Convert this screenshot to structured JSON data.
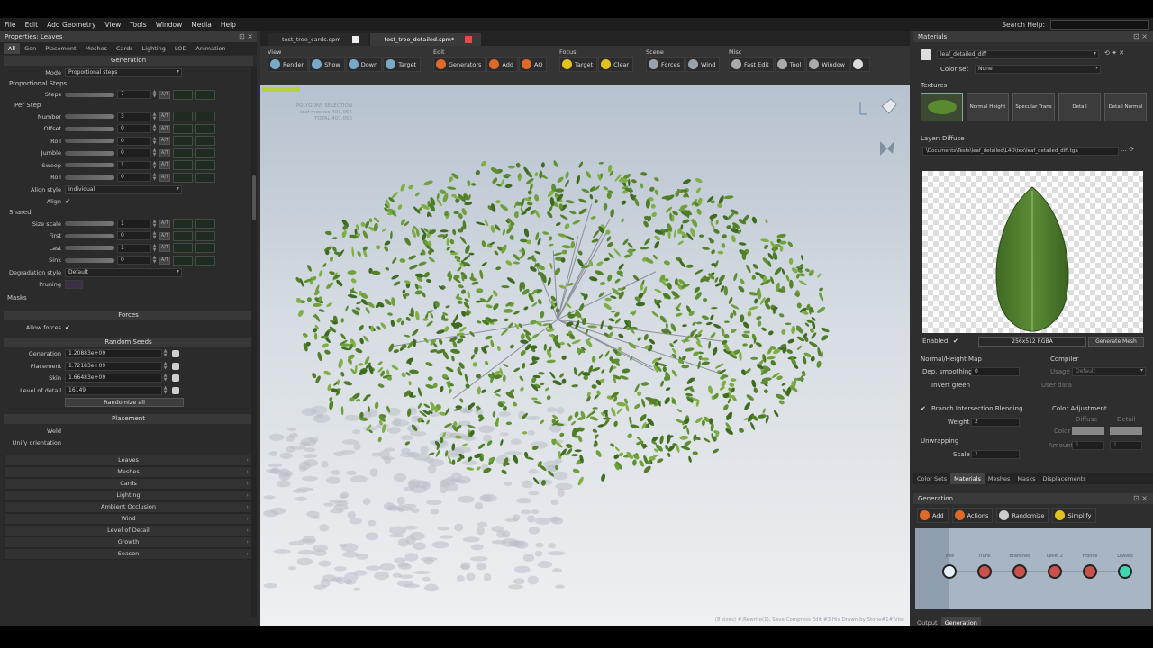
{
  "menu": [
    "File",
    "Edit",
    "Add Geometry",
    "View",
    "Tools",
    "Window",
    "Media",
    "Help"
  ],
  "search_help": "Search Help:",
  "left": {
    "title": "Properties: Leaves",
    "tabs": [
      "All",
      "Gen",
      "Placement",
      "Meshes",
      "Cards",
      "Lighting",
      "LOD",
      "Animation"
    ],
    "generation_header": "Generation",
    "mode_label": "Mode",
    "mode_value": "Proportional steps",
    "proportional_steps": "Proportional Steps",
    "steps_label": "Steps",
    "steps_value": "7",
    "per_step": "Per Step",
    "per_step_rows": [
      {
        "label": "Number",
        "value": "3"
      },
      {
        "label": "Offset",
        "value": "0"
      },
      {
        "label": "Roll",
        "value": "0"
      },
      {
        "label": "Jumble",
        "value": "0"
      },
      {
        "label": "Sweep",
        "value": "1"
      },
      {
        "label": "Roll",
        "value": "0"
      }
    ],
    "align_style_label": "Align style",
    "align_style_value": "Individual",
    "align_label": "Align",
    "shared": "Shared",
    "shared_rows": [
      {
        "label": "Size scale",
        "value": "1"
      },
      {
        "label": "First",
        "value": "0"
      },
      {
        "label": "Last",
        "value": "1"
      },
      {
        "label": "Sink",
        "value": "0"
      }
    ],
    "degradation_label": "Degradation style",
    "degradation_value": "Default",
    "pruning_label": "Pruning",
    "masks": "Masks",
    "forces_header": "Forces",
    "allow_forces": "Allow forces",
    "random_header": "Random Seeds",
    "seeds": [
      {
        "label": "Generation",
        "value": "1.20883e+09"
      },
      {
        "label": "Placement",
        "value": "1.72183e+09"
      },
      {
        "label": "Skin",
        "value": "1.66483e+09"
      },
      {
        "label": "Level of detail",
        "value": "16149"
      }
    ],
    "randomize_all": "Randomize all",
    "placement_header": "Placement",
    "weld_label": "Weld",
    "unify_label": "Unify orientation",
    "collapsed": [
      "Leaves",
      "Meshes",
      "Cards",
      "Lighting",
      "Ambient Occlusion",
      "Wind",
      "Level of Detail",
      "Growth",
      "Season"
    ]
  },
  "center": {
    "tabs": [
      {
        "label": "test_tree_cards.spm",
        "active": false
      },
      {
        "label": "test_tree_detailed.spm*",
        "active": true
      }
    ],
    "groups": [
      {
        "title": "View",
        "buttons": [
          {
            "label": "Render",
            "color": "#79a9c9"
          },
          {
            "label": "Show",
            "color": "#79a9c9"
          },
          {
            "label": "Down",
            "color": "#79a9c9"
          },
          {
            "label": "Target",
            "color": "#79a9c9"
          }
        ]
      },
      {
        "title": "Edit",
        "buttons": [
          {
            "label": "Generators",
            "color": "#e0692a"
          },
          {
            "label": "Add",
            "color": "#e0692a"
          },
          {
            "label": "AO",
            "color": "#e0692a"
          }
        ]
      },
      {
        "title": "Focus",
        "buttons": [
          {
            "label": "Target",
            "color": "#e2c21f"
          },
          {
            "label": "Clear",
            "color": "#e2c21f"
          }
        ]
      },
      {
        "title": "Scene",
        "buttons": [
          {
            "label": "Forces",
            "color": "#9aa3ad"
          },
          {
            "label": "Wind",
            "color": "#9aa3ad"
          }
        ]
      },
      {
        "title": "Misc",
        "buttons": [
          {
            "label": "Fast Edit",
            "color": "#aaaaaa"
          },
          {
            "label": "Tool",
            "color": "#aaaaaa"
          },
          {
            "label": "Window",
            "color": "#aaaaaa"
          },
          {
            "label": "",
            "color": "#dddddd"
          }
        ]
      }
    ],
    "viewport": {
      "info_lines": [
        "POLYGONS   SELECTION",
        "leaf meshes  401,056",
        "TOTAL  401,056"
      ],
      "status": "(8 sizes) #:Rewrite(1), Save Compress Edit #3  Hix Drawn by Stone#1#  Visc"
    }
  },
  "right": {
    "title": "Materials",
    "material_name": "leaf_detailed_diff",
    "color_set_label": "Color set",
    "color_set_value": "None",
    "textures_label": "Textures",
    "tex_slots": [
      "Normal Height",
      "Specular Trans",
      "Detail",
      "Detail Normal"
    ],
    "layer_label": "Layer: Diffuse",
    "path": "\\Documents\\Tests\\leaf_detailed\\L4O\\tex\\leaf_detailed_diff.tga",
    "enabled_label": "Enabled",
    "image_info": "256x512 RGBA",
    "generate_mesh": "Generate Mesh",
    "normal_height": "Normal/Height Map",
    "dep_smoothing_label": "Dep. smoothing",
    "dep_smoothing_value": "0",
    "invert_green": "Invert green",
    "compiler": "Compiler",
    "usage_label": "Usage",
    "usage_value": "Default",
    "user_data_label": "User data",
    "branch_blending": "Branch Intersection Blending",
    "weight_label": "Weight",
    "weight_value": "2",
    "color_adjust": "Color Adjustment",
    "diffuse_col": "Diffuse",
    "detail_col": "Detail",
    "color_label": "Color",
    "amount_label": "Amount",
    "amount_values": [
      "1",
      "1"
    ],
    "unwrapping": "Unwrapping",
    "scale_label": "Scale",
    "scale_value": "1",
    "tabs": [
      {
        "label": "Color Sets",
        "active": false
      },
      {
        "label": "Materials",
        "active": true
      },
      {
        "label": "Meshes",
        "active": false
      },
      {
        "label": "Masks",
        "active": false
      },
      {
        "label": "Displacements",
        "active": false
      }
    ],
    "generation_title": "Generation",
    "gen_buttons": [
      {
        "label": "Add",
        "color": "#e0692a"
      },
      {
        "label": "Actions",
        "color": "#e0692a"
      },
      {
        "label": "Randomize",
        "color": "#cccccc"
      },
      {
        "label": "Simplify",
        "color": "#e2c21f"
      }
    ],
    "nodes": [
      {
        "label": "Tree",
        "color": "#e8f0f8"
      },
      {
        "label": "Trunk",
        "color": "#c9504d"
      },
      {
        "label": "Branches",
        "color": "#c9504d"
      },
      {
        "label": "Level 2",
        "color": "#c9504d"
      },
      {
        "label": "Fronds",
        "color": "#c9504d"
      },
      {
        "label": "Leaves",
        "color": "#3fd6b0"
      }
    ],
    "bottom_tabs": [
      {
        "label": "Output",
        "active": false
      },
      {
        "label": "Generation",
        "active": true
      }
    ]
  }
}
